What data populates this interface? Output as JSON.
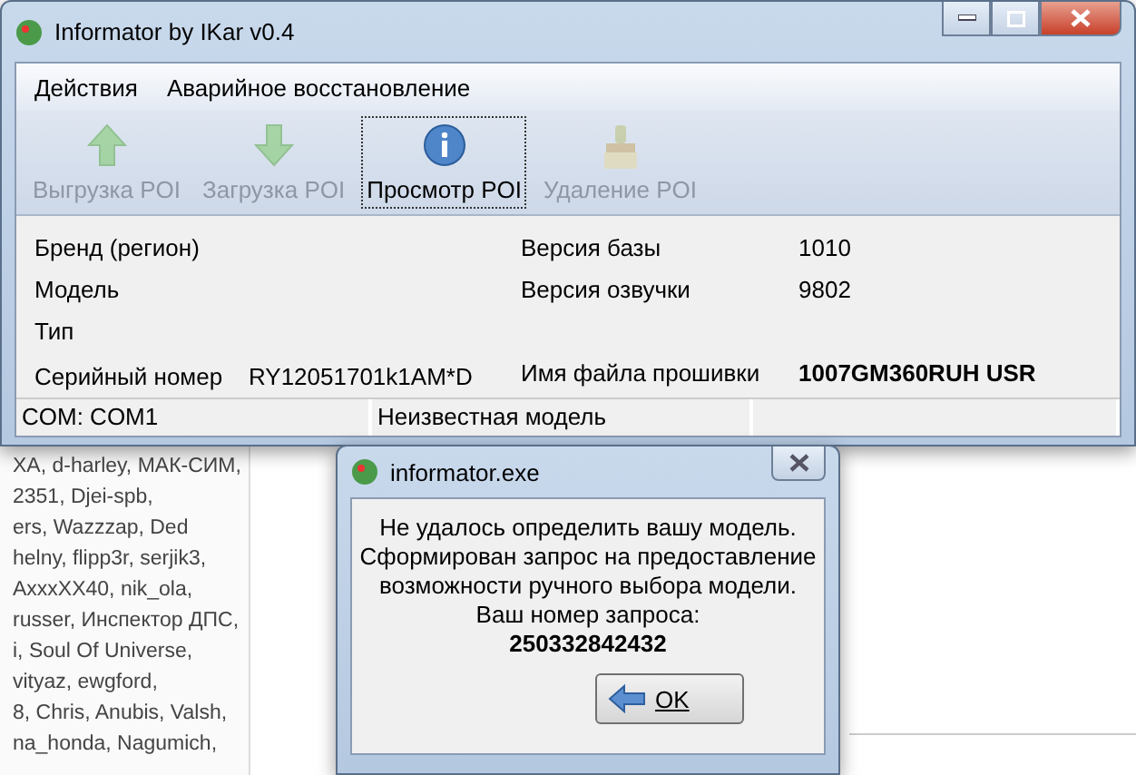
{
  "background_page": {
    "names_lines": [
      "XA, d-harley, МАК-СИМ,",
      "2351, Djei-spb,",
      "ers, Wazzzap, Ded",
      "helny, flipp3r, serjik3,",
      "AxxxXX40, nik_ola,",
      "russer, Инспектор ДПС,",
      "i, Soul Of Universe,",
      "vityaz, ewgford,",
      "8, Chris, Anubis, Valsh,",
      "na_honda, Nagumich,"
    ]
  },
  "window": {
    "title": "Informator by IKar v0.4",
    "menu": [
      "Действия",
      "Аварийное восстановление"
    ],
    "toolbar": [
      {
        "label": "Выгрузка POI",
        "kind": "upload",
        "disabled": true,
        "selected": false
      },
      {
        "label": "Загрузка POI",
        "kind": "download",
        "disabled": true,
        "selected": false
      },
      {
        "label": "Просмотр POI",
        "kind": "info",
        "disabled": false,
        "selected": true
      },
      {
        "label": "Удаление POI",
        "kind": "brush",
        "disabled": true,
        "selected": false
      }
    ],
    "info_left": [
      {
        "label": "Бренд (регион)"
      },
      {
        "label": "Модель"
      },
      {
        "label": "Тип"
      },
      {
        "label": "Серийный номер",
        "value": "RY12051701k1AM*D"
      }
    ],
    "info_right": [
      {
        "label": "Версия базы",
        "value": "1010",
        "bold": false
      },
      {
        "label": "Версия озвучки",
        "value": "9802",
        "bold": false
      },
      {
        "label": "Имя файла прошивки",
        "value": "1007GM360RUH USR",
        "bold": true
      }
    ],
    "status_bar": [
      "COM: COM1",
      "Неизвестная модель"
    ]
  },
  "dialog": {
    "title": "informator.exe",
    "message_lines": [
      "Не удалось определить вашу модель.",
      "Сформирован запрос на предоставление",
      "возможности ручного выбора модели.",
      "Ваш номер запроса:"
    ],
    "request_number": "250332842432",
    "button": "OK"
  }
}
